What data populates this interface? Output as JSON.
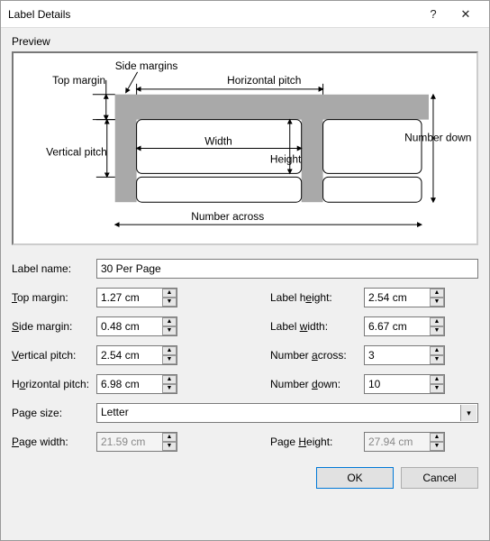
{
  "titlebar": {
    "title": "Label Details"
  },
  "preview": {
    "label": "Preview"
  },
  "diagram": {
    "side_margins": "Side margins",
    "top_margin": "Top margin",
    "horizontal_pitch": "Horizontal pitch",
    "vertical_pitch": "Vertical pitch",
    "width": "Width",
    "height": "Height",
    "number_down": "Number down",
    "number_across": "Number across"
  },
  "form": {
    "label_name": {
      "label": "Label name:",
      "value": "30 Per Page"
    },
    "top_margin": {
      "label": "Top margin:",
      "value": "1.27 cm",
      "u": "T"
    },
    "side_margin": {
      "label": "Side margin:",
      "value": "0.48 cm",
      "u": "S"
    },
    "vertical_pitch": {
      "label": "Vertical pitch:",
      "value": "2.54 cm",
      "u": "V"
    },
    "horizontal_pitch": {
      "label": "Horizontal pitch:",
      "value": "6.98 cm",
      "u": "o"
    },
    "label_height": {
      "label": "Label height:",
      "value": "2.54 cm",
      "u": "E"
    },
    "label_width": {
      "label": "Label width:",
      "value": "6.67 cm",
      "u": "w"
    },
    "number_across": {
      "label": "Number across:",
      "value": "3",
      "u": "a"
    },
    "number_down": {
      "label": "Number down:",
      "value": "10",
      "u": "d"
    },
    "page_size": {
      "label": "Page size:",
      "value": "Letter"
    },
    "page_width": {
      "label": "Page width:",
      "value": "21.59 cm",
      "u": "P"
    },
    "page_height": {
      "label": "Page Height:",
      "value": "27.94 cm",
      "u": "H"
    }
  },
  "buttons": {
    "ok": "OK",
    "cancel": "Cancel"
  }
}
